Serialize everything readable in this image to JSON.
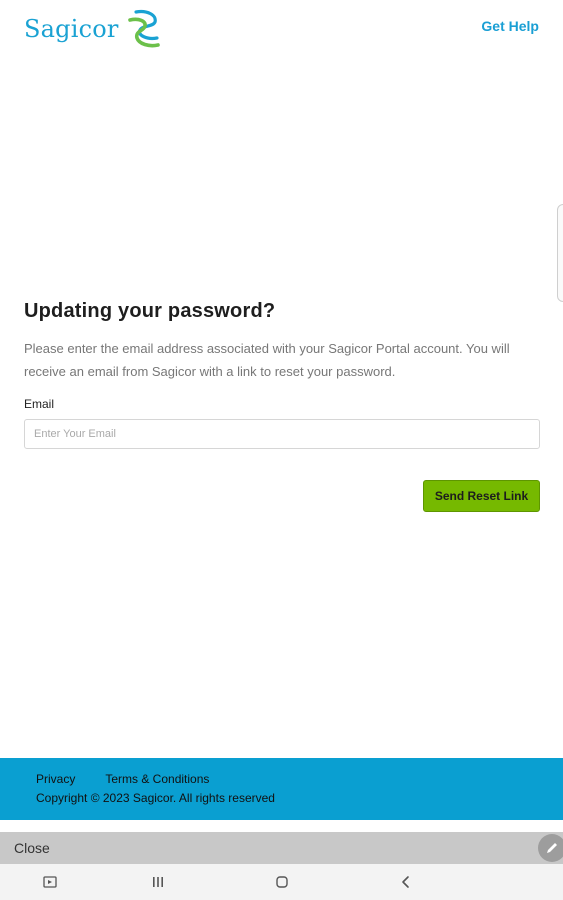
{
  "header": {
    "logo_text": "Sagicor",
    "get_help": "Get Help"
  },
  "form": {
    "title": "Updating your password?",
    "description": "Please enter the email address associated with your Sagicor Portal account. You will receive an email from Sagicor with a link to reset your password.",
    "email_label": "Email",
    "email_placeholder": "Enter Your Email",
    "email_value": "",
    "submit_label": "Send Reset Link"
  },
  "footer": {
    "privacy": "Privacy",
    "terms": "Terms & Conditions",
    "copyright": "Copyright © 2023 Sagicor. All rights reserved"
  },
  "close_bar": {
    "label": "Close"
  },
  "icons": {
    "logo": "sagicor-s-logo-icon",
    "edit": "pencil-icon",
    "nav": [
      "screenshot-icon",
      "recent-apps-icon",
      "home-icon",
      "back-icon"
    ]
  },
  "colors": {
    "brand_blue": "#1aa2d3",
    "brand_green": "#6cc04a",
    "button_green": "#76b900",
    "footer_blue": "#0a9fd1"
  }
}
